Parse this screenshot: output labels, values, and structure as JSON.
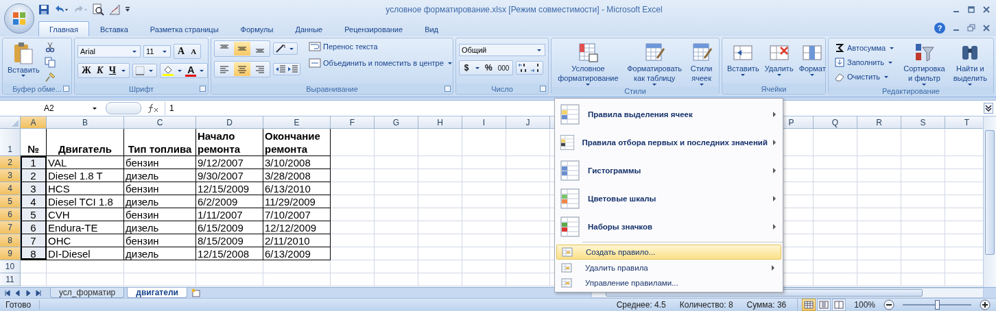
{
  "title_bar": {
    "title": "условное форматирование.xlsx  [Режим совместимости] - Microsoft Excel",
    "help": "?"
  },
  "tabs": [
    {
      "label": "Главная",
      "selected": true
    },
    {
      "label": "Вставка",
      "selected": false
    },
    {
      "label": "Разметка страницы",
      "selected": false
    },
    {
      "label": "Формулы",
      "selected": false
    },
    {
      "label": "Данные",
      "selected": false
    },
    {
      "label": "Рецензирование",
      "selected": false
    },
    {
      "label": "Вид",
      "selected": false
    }
  ],
  "clipboard": {
    "label": "Буфер обме...",
    "paste": "Вставить"
  },
  "font": {
    "label": "Шрифт",
    "name": "Arial",
    "size": "11",
    "grow": "A",
    "shrink": "A",
    "bold": "Ж",
    "italic": "К",
    "underline": "Ч",
    "font_color": "A"
  },
  "alignment": {
    "label": "Выравнивание",
    "vertical": [
      {
        "selected": false
      },
      {
        "selected": true
      },
      {
        "selected": false
      }
    ],
    "horizontal": [
      {
        "selected": false
      },
      {
        "selected": true
      },
      {
        "selected": false
      }
    ],
    "wrap": "Перенос текста",
    "merge": "Объединить и поместить в центре"
  },
  "number": {
    "label": "Число",
    "format": "Общий",
    "currency": "$",
    "percent": "%",
    "thousands": "000"
  },
  "styles": {
    "label": "Стили",
    "buttons": [
      {
        "lines": [
          "Условное",
          "форматирование"
        ]
      },
      {
        "lines": [
          "Форматировать",
          "как таблицу"
        ]
      },
      {
        "lines": [
          "Стили",
          "ячеек"
        ]
      }
    ]
  },
  "cells": {
    "label": "Ячейки",
    "buttons": [
      {
        "lines": [
          "Вставить"
        ]
      },
      {
        "lines": [
          "Удалить"
        ]
      },
      {
        "lines": [
          "Формат"
        ]
      }
    ]
  },
  "editing": {
    "label": "Редактирование",
    "small": [
      "Автосумма",
      "Заполнить",
      "Очистить"
    ],
    "buttons": [
      {
        "lines": [
          "Сортировка",
          "и фильтр"
        ]
      },
      {
        "lines": [
          "Найти и",
          "выделить"
        ]
      }
    ]
  },
  "formula_bar": {
    "name_box": "A2",
    "value": "1"
  },
  "sheet": {
    "columns": [
      {
        "label": "A",
        "selected": true
      },
      {
        "label": "B",
        "selected": false
      },
      {
        "label": "C",
        "selected": false
      },
      {
        "label": "D",
        "selected": false
      },
      {
        "label": "E",
        "selected": false
      },
      {
        "label": "F",
        "selected": false
      },
      {
        "label": "G",
        "selected": false
      },
      {
        "label": "H",
        "selected": false
      },
      {
        "label": "I",
        "selected": false
      },
      {
        "label": "J",
        "selected": false
      }
    ],
    "columns_right": [
      "P",
      "Q",
      "R",
      "S",
      "T"
    ],
    "rows": [
      {
        "number": "1",
        "selected": false,
        "cells": [
          "№",
          "Двигатель",
          "Тип топлива",
          "Начало ремонта",
          "Окончание ремонта"
        ]
      },
      {
        "number": "2",
        "selected": true,
        "cells": [
          "1",
          "VAL",
          "бензин",
          "9/12/2007",
          "3/10/2008"
        ]
      },
      {
        "number": "3",
        "selected": true,
        "cells": [
          "2",
          "Diesel 1.8 T",
          "дизель",
          "9/30/2007",
          "3/28/2008"
        ]
      },
      {
        "number": "4",
        "selected": true,
        "cells": [
          "3",
          "HCS",
          "бензин",
          "12/15/2009",
          "6/13/2010"
        ]
      },
      {
        "number": "5",
        "selected": true,
        "cells": [
          "4",
          "Diesel TCI 1.8",
          "дизель",
          "6/2/2009",
          "11/29/2009"
        ]
      },
      {
        "number": "6",
        "selected": true,
        "cells": [
          "5",
          "CVH",
          "бензин",
          "1/11/2007",
          "7/10/2007"
        ]
      },
      {
        "number": "7",
        "selected": true,
        "cells": [
          "6",
          "Endura-TE",
          "дизель",
          "6/15/2009",
          "12/12/2009"
        ]
      },
      {
        "number": "8",
        "selected": true,
        "cells": [
          "7",
          "OHC",
          "бензин",
          "8/15/2009",
          "2/11/2010"
        ]
      },
      {
        "number": "9",
        "selected": true,
        "cells": [
          "8",
          "DI-Diesel",
          "дизель",
          "12/15/2008",
          "6/13/2009"
        ]
      },
      {
        "number": "10",
        "selected": false
      },
      {
        "number": "11",
        "selected": false
      }
    ]
  },
  "sheet_tabs": [
    {
      "label": "усл_форматир",
      "selected": false
    },
    {
      "label": "двигатели",
      "selected": true
    }
  ],
  "menu": {
    "items": [
      {
        "kind": "large",
        "label": "Правила выделения ячеек",
        "submenu": true,
        "selected": false
      },
      {
        "kind": "large",
        "label": "Правила отбора первых и последних значений",
        "submenu": true,
        "selected": false
      },
      {
        "kind": "large",
        "label": "Гистограммы",
        "submenu": true,
        "selected": false
      },
      {
        "kind": "large",
        "label": "Цветовые шкалы",
        "submenu": true,
        "selected": false
      },
      {
        "kind": "large",
        "label": "Наборы значков",
        "submenu": true,
        "selected": false
      },
      {
        "kind": "small",
        "label": "Создать правило...",
        "submenu": false,
        "selected": true
      },
      {
        "kind": "small",
        "label": "Удалить правила",
        "submenu": true,
        "selected": false
      },
      {
        "kind": "small",
        "label": "Управление правилами...",
        "submenu": false,
        "selected": false
      }
    ]
  },
  "status_bar": {
    "ready": "Готово",
    "average": "Среднее: 4.5",
    "count": "Количество: 8",
    "sum": "Сумма: 36",
    "views": [
      {
        "selected": true
      },
      {
        "selected": false
      },
      {
        "selected": false
      }
    ],
    "zoom": "100%",
    "zoom_slider": {
      "level": 0.5
    }
  }
}
